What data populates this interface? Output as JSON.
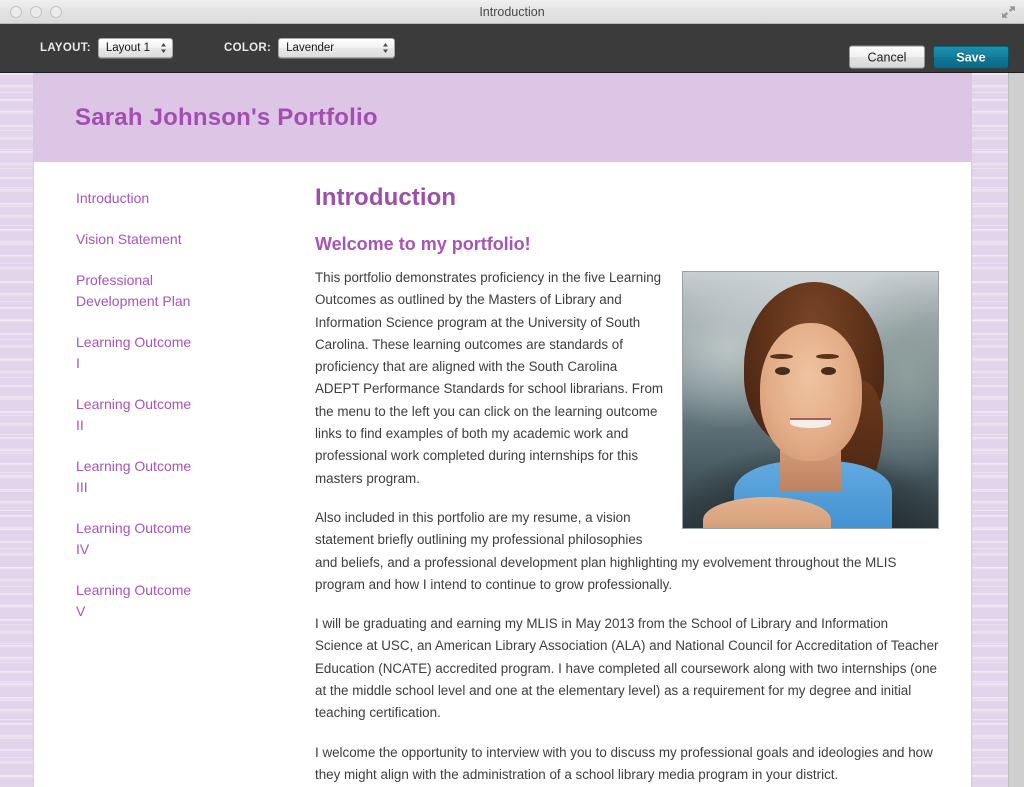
{
  "window": {
    "title": "Introduction",
    "traffic_lights": [
      "close",
      "minimize",
      "zoom"
    ],
    "fullscreen_icon": "fullscreen-icon"
  },
  "toolbar": {
    "layout_label": "LAYOUT:",
    "layout_value": "Layout 1",
    "color_label": "COLOR:",
    "color_value": "Lavender",
    "cancel_label": "Cancel",
    "save_label": "Save",
    "save_color": "#12819f",
    "background": "#3b3b3b"
  },
  "page": {
    "title": "Sarah Johnson's Portfolio",
    "header_bg": "#ddc5e6",
    "accent_color": "#a655b4",
    "heading_color": "#9b4fa8",
    "canvas_bg": "#e2d4ea"
  },
  "sidebar": {
    "items": [
      {
        "label": "Introduction"
      },
      {
        "label": "Vision Statement"
      },
      {
        "label": "Professional Development Plan"
      },
      {
        "label": "Learning Outcome I"
      },
      {
        "label": "Learning Outcome II"
      },
      {
        "label": "Learning Outcome III"
      },
      {
        "label": "Learning Outcome IV"
      },
      {
        "label": "Learning Outcome V"
      }
    ]
  },
  "main": {
    "heading": "Introduction",
    "subheading": "Welcome to my portfolio!",
    "photo_alt": "Portrait photo of Sarah Johnson",
    "paragraphs": [
      "This portfolio demonstrates proficiency in the five Learning Outcomes as outlined by the Masters of Library and Information Science program at the University of South Carolina. These learning outcomes are standards of proficiency that are aligned with the South Carolina ADEPT Performance Standards for school librarians. From the menu to the left you can click on the learning outcome links to find examples of both my academic work and professional work completed during internships for this masters program.",
      "Also included in this portfolio are my resume, a vision statement briefly outlining my professional philosophies and beliefs, and a professional development plan highlighting my evolvement throughout the MLIS program and how I intend to continue to grow professionally.",
      "I will be graduating and earning my MLIS in May 2013 from the School of Library and Information Science at USC, an American Library Association (ALA) and National Council for Accreditation of Teacher Education (NCATE) accredited program. I have completed all coursework along with two internships (one at the middle school level and one at the elementary level) as a requirement for my degree and initial teaching certification.",
      "I welcome the opportunity to interview with you to discuss my professional goals and ideologies and how they might align with the administration of a school library media program in your district."
    ]
  }
}
